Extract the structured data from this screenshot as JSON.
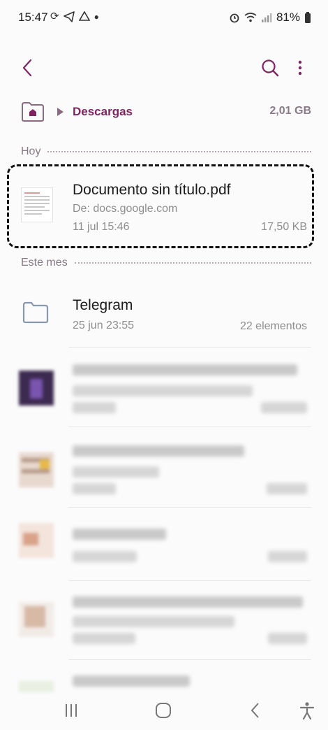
{
  "status_bar": {
    "time": "15:47",
    "left_icons": [
      "sync-icon",
      "telegram-icon",
      "drive-icon",
      "dot-icon"
    ],
    "right_icons": [
      "alarm-icon",
      "wifi-icon",
      "signal-icon"
    ],
    "battery_percent": "81%"
  },
  "app_bar": {
    "back_icon": "chevron-left-icon",
    "search_icon": "search-icon",
    "more_icon": "more-vert-icon"
  },
  "breadcrumb": {
    "home_icon": "home-folder-icon",
    "folder": "Descargas",
    "size": "2,01 GB"
  },
  "sections": {
    "today": "Hoy",
    "this_month": "Este mes"
  },
  "files": [
    {
      "name": "Documento sin título.pdf",
      "source": "De: docs.google.com",
      "date": "11 jul 15:46",
      "size": "17,50 KB",
      "highlighted": true
    }
  ],
  "folders": [
    {
      "name": "Telegram",
      "date": "25 jun 23:55",
      "count": "22 elementos"
    }
  ],
  "colors": {
    "accent": "#7d2461",
    "secondary_text": "#8e8e8e",
    "section_text": "#8a7a85",
    "background": "#fbfbfb"
  }
}
